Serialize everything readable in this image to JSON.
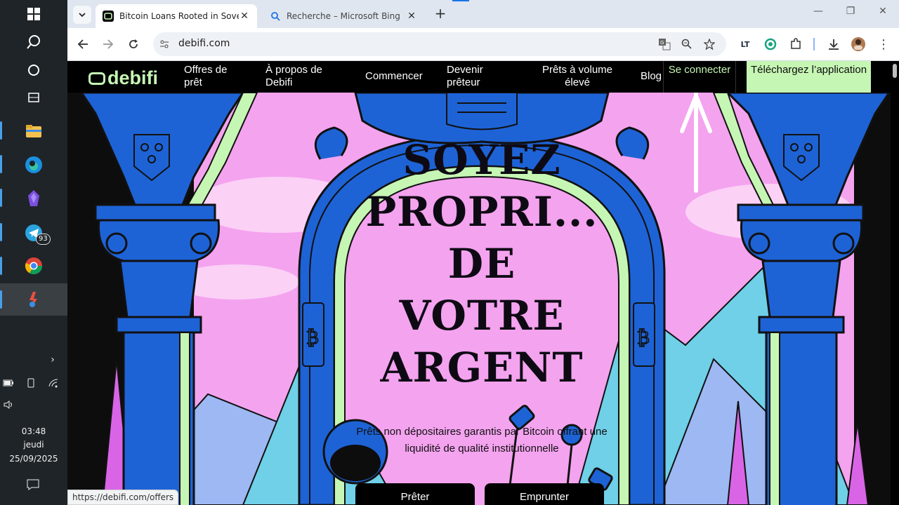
{
  "taskbar": {
    "icons": [
      "windows-start",
      "search",
      "task-view",
      "widgets",
      "file-explorer",
      "edge",
      "obsidian",
      "telegram",
      "chrome",
      "app-pinned"
    ],
    "telegram_badge": "93",
    "time": "03:48",
    "day": "jeudi",
    "date": "25/09/2025"
  },
  "browser": {
    "tabs": [
      {
        "title": "Bitcoin Loans Rooted in Sovereignty",
        "active": true
      },
      {
        "title": "Recherche – Microsoft Bing",
        "active": false
      }
    ],
    "url": "debifi.com",
    "status_url": "https://debifi.com/offers"
  },
  "site": {
    "logo": "debifi",
    "nav": {
      "offers": "Offres de prêt",
      "about": "À propos de Debifi",
      "start": "Commencer",
      "become_lender": "Devenir prêteur",
      "high_volume": "Prêts à volume élevé",
      "blog": "Blog",
      "login": "Se connecter",
      "download": "Téléchargez l’application"
    },
    "hero": {
      "title_lines": [
        "SOYEZ",
        "PROPRI...",
        "DE",
        "VOTRE",
        "ARGENT"
      ],
      "subtitle": "Prêts non dépositaires garantis par Bitcoin offrant une liquidité de qualité institutionnelle",
      "cta_lend": "Prêter",
      "cta_borrow": "Emprunter"
    }
  },
  "colors": {
    "accent_green": "#c6f6b4",
    "column_blue": "#1e63d6",
    "sky_pink": "#f6a6f0",
    "nav_bg": "#000000"
  }
}
